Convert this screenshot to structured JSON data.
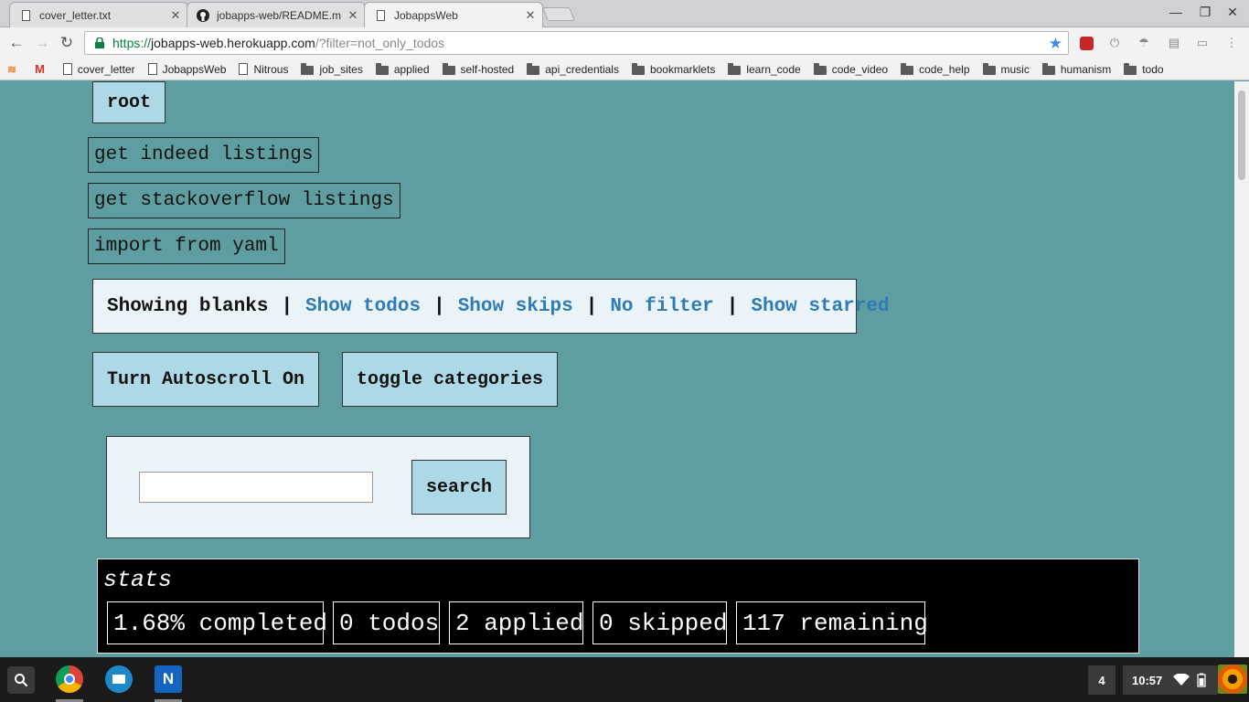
{
  "browser": {
    "tabs": [
      {
        "title": "cover_letter.txt",
        "icon": "page-icon",
        "active": false
      },
      {
        "title": "jobapps-web/README.m",
        "icon": "github-icon",
        "active": false
      },
      {
        "title": "JobappsWeb",
        "icon": "page-icon",
        "active": true
      }
    ],
    "url": {
      "scheme": "https://",
      "host": "jobapps-web.herokuapp.com",
      "path": "/?filter=not_only_todos"
    },
    "bookmarks": [
      {
        "label": "cover_letter",
        "icon": "page-icon"
      },
      {
        "label": "JobappsWeb",
        "icon": "page-icon"
      },
      {
        "label": "Nitrous",
        "icon": "page-icon"
      },
      {
        "label": "job_sites",
        "icon": "folder-icon"
      },
      {
        "label": "applied",
        "icon": "folder-icon"
      },
      {
        "label": "self-hosted",
        "icon": "folder-icon"
      },
      {
        "label": "api_credentials",
        "icon": "folder-icon"
      },
      {
        "label": "bookmarklets",
        "icon": "folder-icon"
      },
      {
        "label": "learn_code",
        "icon": "folder-icon"
      },
      {
        "label": "code_video",
        "icon": "folder-icon"
      },
      {
        "label": "code_help",
        "icon": "folder-icon"
      },
      {
        "label": "music",
        "icon": "folder-icon"
      },
      {
        "label": "humanism",
        "icon": "folder-icon"
      },
      {
        "label": "todo",
        "icon": "folder-icon"
      }
    ]
  },
  "page": {
    "root_label": "root",
    "actions": {
      "indeed": "get indeed listings",
      "stackoverflow": "get stackoverflow listings",
      "yaml": "import from yaml"
    },
    "filters": {
      "current": "Showing blanks",
      "separator": "|",
      "links": [
        "Show todos",
        "Show skips",
        "No filter",
        "Show starred"
      ]
    },
    "autoscroll_label": "Turn Autoscroll On",
    "toggle_categories_label": "toggle categories",
    "search": {
      "value": "",
      "button_label": "search"
    },
    "stats": {
      "title": "stats",
      "completed": "1.68% completed",
      "todos": "0 todos",
      "applied": "2 applied",
      "skipped": "0 skipped",
      "remaining": "117 remaining"
    }
  },
  "shelf": {
    "notification_count": "4",
    "time": "10:57"
  },
  "colors": {
    "page_bg": "#5f9ea0",
    "button_bg": "#add8e6",
    "link": "#2e7bb5",
    "stats_bg": "#000000"
  }
}
